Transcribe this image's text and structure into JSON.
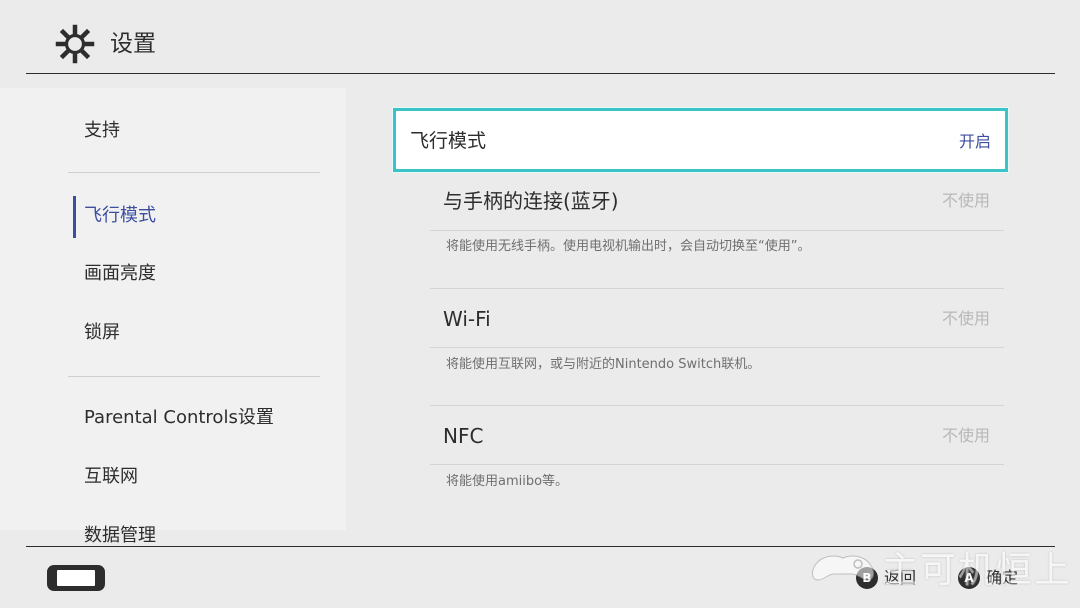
{
  "header": {
    "title": "设置",
    "icon": "gear-icon"
  },
  "sidebar": {
    "items": [
      {
        "label": "支持"
      },
      {
        "label": "飞行模式",
        "active": true
      },
      {
        "label": "画面亮度"
      },
      {
        "label": "锁屏"
      },
      {
        "label": "Parental Controls设置"
      },
      {
        "label": "互联网"
      },
      {
        "label": "数据管理"
      }
    ]
  },
  "main": {
    "focused": {
      "label": "飞行模式",
      "value": "开启"
    },
    "rows": [
      {
        "label": "与手柄的连接(蓝牙)",
        "value": "不使用",
        "description": "将能使用无线手柄。使用电视机输出时，会自动切换至“使用”。"
      },
      {
        "label": "Wi-Fi",
        "value": "不使用",
        "description": "将能使用互联网，或与附近的Nintendo Switch联机。"
      },
      {
        "label": "NFC",
        "value": "不使用",
        "description": "将能使用amiibo等。"
      }
    ]
  },
  "footer": {
    "back": {
      "key": "B",
      "label": "返回"
    },
    "confirm": {
      "key": "A",
      "label": "确定"
    },
    "device_icon": "switch-console-icon"
  },
  "watermark": {
    "text": "主可机恒上"
  },
  "colors": {
    "background": "#ebebeb",
    "sidebar_bg": "#f1f1f1",
    "accent": "#3c4ea0",
    "focus_border": "#3bc3c8",
    "muted": "#b8b8b8"
  }
}
